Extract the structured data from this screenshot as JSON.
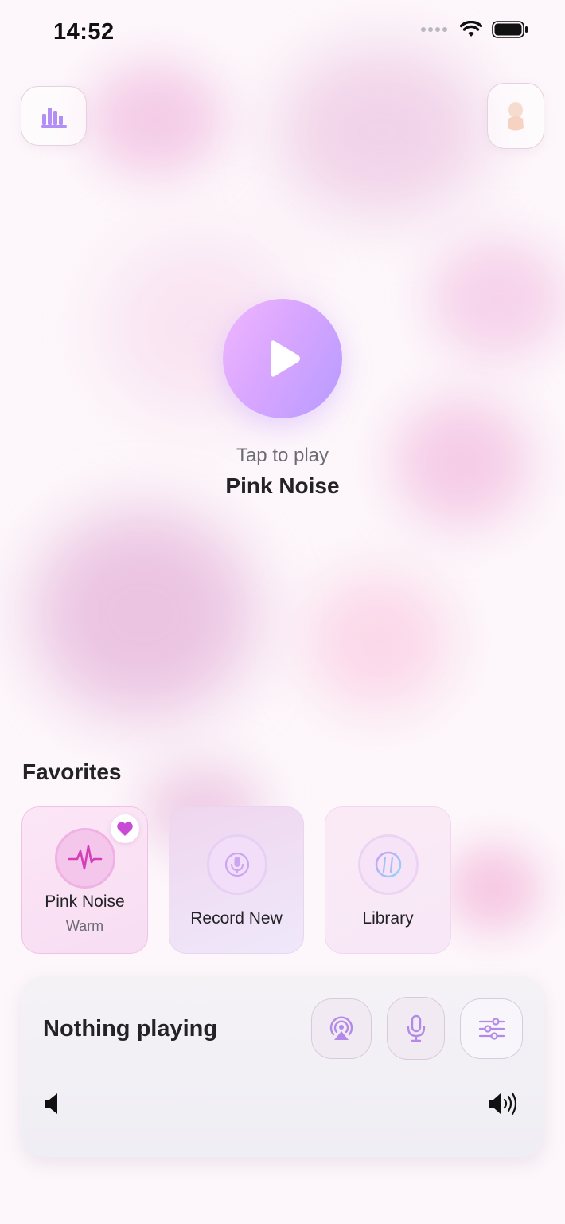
{
  "status_bar": {
    "time": "14:52",
    "icons": [
      "signal-icon",
      "wifi-icon",
      "battery-icon"
    ]
  },
  "header": {
    "left_button_icon": "bar-chart-icon",
    "right_button_icon": "profile-icon"
  },
  "hero": {
    "play_icon": "play-icon",
    "hint": "Tap to play",
    "title": "Pink Noise"
  },
  "favorites": {
    "title": "Favorites",
    "items": [
      {
        "label": "Pink Noise",
        "subtitle": "Warm",
        "icon": "waveform-icon",
        "favorited": true
      },
      {
        "label": "Record New",
        "icon": "microphone-icon"
      },
      {
        "label": "Library",
        "icon": "hashtag-icon"
      }
    ]
  },
  "player": {
    "status": "Nothing playing",
    "buttons": [
      "airplay-icon",
      "microphone-icon",
      "sliders-icon"
    ],
    "volume_min_icon": "speaker-low-icon",
    "volume_max_icon": "speaker-high-icon"
  },
  "colors": {
    "background": "#fdf7fb",
    "accent_purple": "#b79bff",
    "accent_pink": "#f0b6ff",
    "heart": "#c84bd6",
    "waveform": "#d33fb6"
  }
}
